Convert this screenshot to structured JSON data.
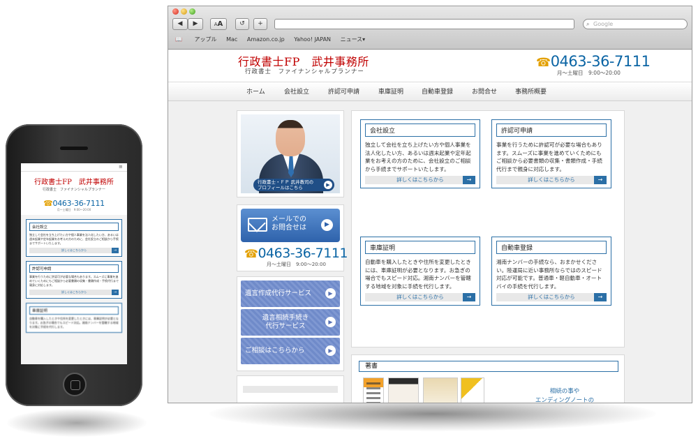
{
  "site": {
    "title": "行政書士FP　武井事務所",
    "subtitle": "行政書士　ファイナンシャルプランナー",
    "phone": "0463-36-7111",
    "hours": "月〜土曜日　9:00〜20:00",
    "phone_icon": "☎"
  },
  "browser": {
    "nav_back": "◀",
    "nav_forward": "▶",
    "font_small": "A",
    "font_large": "A",
    "reload": "↺",
    "add": "+",
    "search_placeholder": "Google",
    "bookmarks": [
      "アップル",
      "Mac",
      "Amazon.co.jp",
      "Yahoo! JAPAN",
      "ニュース▾"
    ]
  },
  "nav": [
    "ホーム",
    "会社設立",
    "許認可申請",
    "車庫証明",
    "自動車登録",
    "お問合せ",
    "事務所概要"
  ],
  "profile": {
    "label_line1": "行政書士・ＦＰ 武井教司の",
    "label_line2": "プロフィールはこちら",
    "arrow": "▶"
  },
  "contact": {
    "mail_line1": "メールでの",
    "mail_line2": "お問合せは",
    "arrow": "▶"
  },
  "services": [
    {
      "line1": "遺言作成代行サービス",
      "line2": ""
    },
    {
      "line1": "遺言相続手続き",
      "line2": "代行サービス"
    },
    {
      "line1": "ご相談はこちらから",
      "line2": ""
    }
  ],
  "cards": [
    {
      "title": "会社設立",
      "text": "独立して会社を立ち上げたい方や個人事業を法人化したい方、あるいは週末起業や定年起業をお考えの方のために、会社設立のご相談から手続までサポートいたします。",
      "button": "詳しくはこちらから"
    },
    {
      "title": "許認可申請",
      "text": "事業を行うために許認可が必要な場合もあります。スムーズに事業を進めていくためにもご相談から必要書類の収集・書類作成・手続代行まで親身に対応します。",
      "button": "詳しくはこちらから"
    },
    {
      "title": "車庫証明",
      "text": "自動車を購入したときや住所を変更したときには、車庫証明が必要となります。お急ぎの場合でもスピード対応。湘南ナンバーを管轄する地域を対象に手続を代行します。",
      "button": "詳しくはこちらから"
    },
    {
      "title": "自動車登録",
      "text": "湘南ナンバーの手続なら、おまかせください。陸運局に近い事務所ならではのスピード対応が可能です。普通車・軽自動車・オートバイの手続を代行します。",
      "button": "詳しくはこちらから"
    }
  ],
  "books": {
    "title": "著書",
    "text_line1": "相続の事や",
    "text_line2": "エンディングノートの"
  },
  "mobile": {
    "menu_icon": "≡",
    "card_arrow": "→"
  },
  "arrow_right": "→"
}
